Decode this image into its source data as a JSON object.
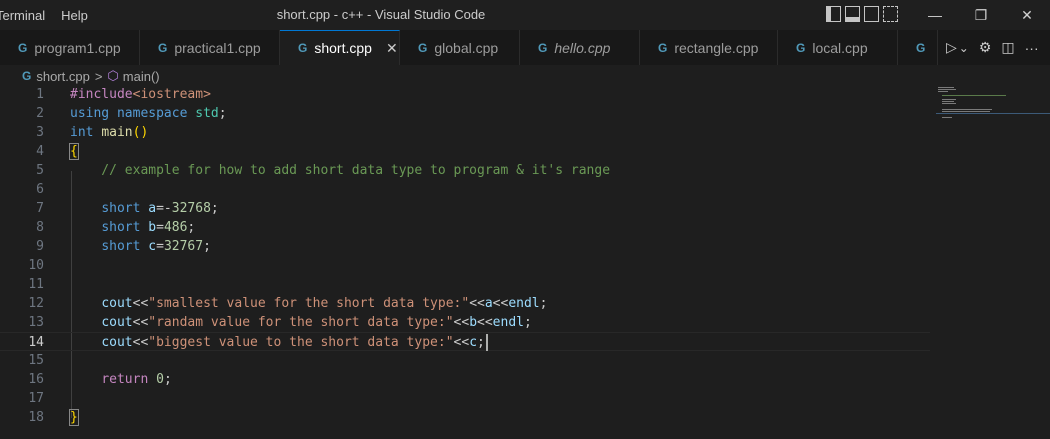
{
  "menu": [
    "Terminal",
    "Help"
  ],
  "window_title": "short.cpp - c++ - Visual Studio Code",
  "window_controls": {
    "minimize": "—",
    "restore": "❐",
    "close": "✕"
  },
  "tabs": [
    {
      "label": "program1.cpp",
      "icon": "C",
      "active": false,
      "italic": false,
      "width": 140
    },
    {
      "label": "practical1.cpp",
      "icon": "C",
      "active": false,
      "italic": false,
      "width": 140
    },
    {
      "label": "short.cpp",
      "icon": "C",
      "active": true,
      "italic": false,
      "width": 120
    },
    {
      "label": "global.cpp",
      "icon": "C",
      "active": false,
      "italic": false,
      "width": 120
    },
    {
      "label": "hello.cpp",
      "icon": "C",
      "active": false,
      "italic": true,
      "width": 120
    },
    {
      "label": "rectangle.cpp",
      "icon": "C",
      "active": false,
      "italic": false,
      "width": 138
    },
    {
      "label": "local.cpp",
      "icon": "C",
      "active": false,
      "italic": false,
      "width": 120
    },
    {
      "label": "",
      "icon": "C",
      "active": false,
      "italic": false,
      "width": 40
    }
  ],
  "active_tab_close": "✕",
  "editor_actions": {
    "run": "▷",
    "run_dropdown": "⌄",
    "settings": "⚙",
    "split": "◫",
    "more": "···"
  },
  "breadcrumb": {
    "file": "short.cpp",
    "separator": ">",
    "symbol": "main()"
  },
  "current_line": 14,
  "code_lines": [
    {
      "n": 1,
      "tokens": [
        [
          "k-pre",
          "#include"
        ],
        [
          "k-inc",
          "<iostream>"
        ]
      ]
    },
    {
      "n": 2,
      "tokens": [
        [
          "k-kw",
          "using"
        ],
        [
          "",
          " "
        ],
        [
          "k-kw",
          "namespace"
        ],
        [
          "",
          " "
        ],
        [
          "k-ns",
          "std"
        ],
        [
          "",
          ";"
        ]
      ]
    },
    {
      "n": 3,
      "tokens": [
        [
          "k-kw",
          "int"
        ],
        [
          "",
          " "
        ],
        [
          "k-fn",
          "main"
        ],
        [
          "k-br1",
          "()"
        ]
      ]
    },
    {
      "n": 4,
      "tokens": [
        [
          "k-br1 bracket-box",
          "{"
        ]
      ]
    },
    {
      "n": 5,
      "tokens": [
        [
          "k-com",
          "    // example for how to add short data type to program & it's range"
        ]
      ]
    },
    {
      "n": 6,
      "tokens": []
    },
    {
      "n": 7,
      "tokens": [
        [
          "",
          "    "
        ],
        [
          "k-kw",
          "short"
        ],
        [
          "",
          " "
        ],
        [
          "k-var",
          "a"
        ],
        [
          "",
          "=-"
        ],
        [
          "k-num",
          "32768"
        ],
        [
          "",
          ";"
        ]
      ]
    },
    {
      "n": 8,
      "tokens": [
        [
          "",
          "    "
        ],
        [
          "k-kw",
          "short"
        ],
        [
          "",
          " "
        ],
        [
          "k-var",
          "b"
        ],
        [
          "",
          "="
        ],
        [
          "k-num",
          "486"
        ],
        [
          "",
          ";"
        ]
      ]
    },
    {
      "n": 9,
      "tokens": [
        [
          "",
          "    "
        ],
        [
          "k-kw",
          "short"
        ],
        [
          "",
          " "
        ],
        [
          "k-var",
          "c"
        ],
        [
          "",
          "="
        ],
        [
          "k-num",
          "32767"
        ],
        [
          "",
          ";"
        ]
      ]
    },
    {
      "n": 10,
      "tokens": []
    },
    {
      "n": 11,
      "tokens": []
    },
    {
      "n": 12,
      "tokens": [
        [
          "",
          "    "
        ],
        [
          "k-var",
          "cout"
        ],
        [
          "",
          "<<"
        ],
        [
          "k-str",
          "\"smallest value for the short data type:\""
        ],
        [
          "",
          "<<"
        ],
        [
          "k-var",
          "a"
        ],
        [
          "",
          "<<"
        ],
        [
          "k-var",
          "endl"
        ],
        [
          "",
          ";"
        ]
      ]
    },
    {
      "n": 13,
      "tokens": [
        [
          "",
          "    "
        ],
        [
          "k-var",
          "cout"
        ],
        [
          "",
          "<<"
        ],
        [
          "k-str",
          "\"randam value for the short data type:\""
        ],
        [
          "",
          "<<"
        ],
        [
          "k-var",
          "b"
        ],
        [
          "",
          "<<"
        ],
        [
          "k-var",
          "endl"
        ],
        [
          "",
          ";"
        ]
      ]
    },
    {
      "n": 14,
      "tokens": [
        [
          "",
          "    "
        ],
        [
          "k-var",
          "cout"
        ],
        [
          "",
          "<<"
        ],
        [
          "k-str",
          "\"biggest value to the short data type:\""
        ],
        [
          "",
          "<<"
        ],
        [
          "k-var",
          "c"
        ],
        [
          "",
          ";"
        ]
      ],
      "cursor": true
    },
    {
      "n": 15,
      "tokens": []
    },
    {
      "n": 16,
      "tokens": [
        [
          "",
          "    "
        ],
        [
          "k-ctl",
          "return"
        ],
        [
          "",
          " "
        ],
        [
          "k-num",
          "0"
        ],
        [
          "",
          ";"
        ]
      ]
    },
    {
      "n": 17,
      "tokens": []
    },
    {
      "n": 18,
      "tokens": [
        [
          "k-br1 bracket-box",
          "}"
        ]
      ]
    }
  ]
}
